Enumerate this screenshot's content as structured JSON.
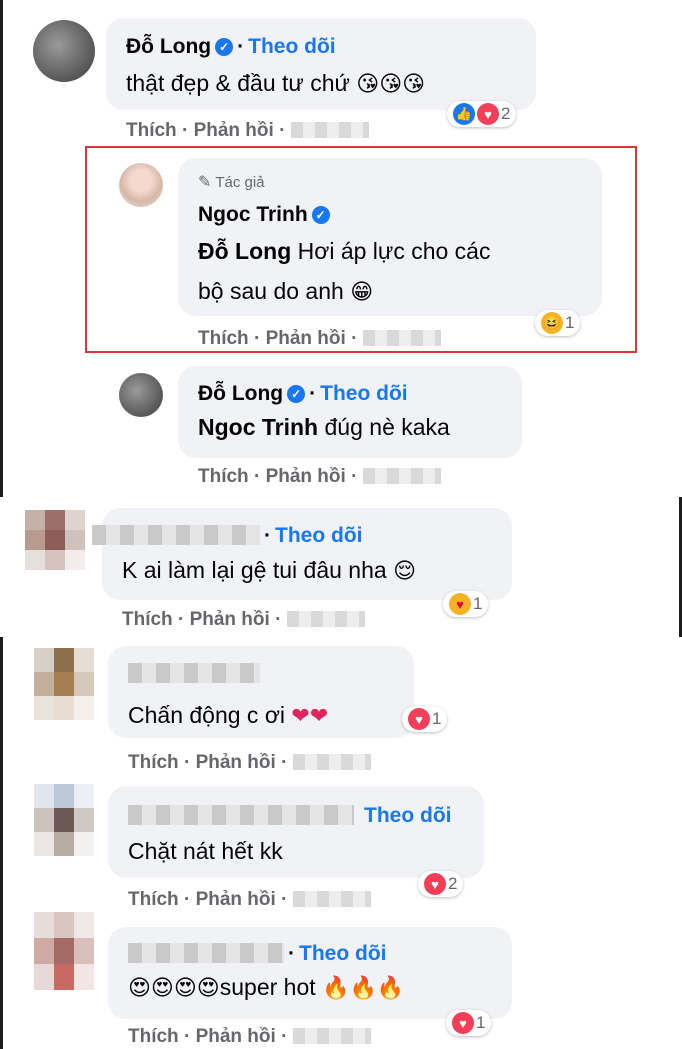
{
  "labels": {
    "follow": "Theo dõi",
    "like": "Thích",
    "reply": "Phản hồi",
    "author_tag": "Tác giả"
  },
  "comments": [
    {
      "name": "Đỗ Long",
      "verified": true,
      "show_follow": true,
      "text": "thật đẹp & đầu tư chứ",
      "emojis": "😘😘😘",
      "reactions": [
        "like-reaction",
        "love-reaction"
      ],
      "reaction_count": "2"
    },
    {
      "name": "Ngoc Trinh",
      "verified": true,
      "is_author": true,
      "mention": "Đỗ Long",
      "text": "Hơi áp lực cho các",
      "text_line2": "bộ sau do anh",
      "emojis": "😁",
      "reactions": [
        "haha-reaction"
      ],
      "reaction_count": "1"
    },
    {
      "name": "Đỗ Long",
      "verified": true,
      "show_follow": true,
      "mention": "Ngoc Trinh",
      "text": "đúg nè kaka"
    },
    {
      "name_blurred": true,
      "show_follow": true,
      "text": "K ai làm lại gệ tui đâu nha",
      "emojis": "😌",
      "reactions": [
        "care-reaction"
      ],
      "reaction_count": "1"
    },
    {
      "name_blurred": true,
      "text": "Chấn động c ơi",
      "emojis": "❤❤",
      "reactions": [
        "love-reaction"
      ],
      "reaction_count": "1"
    },
    {
      "name_blurred": true,
      "show_follow": true,
      "text": "Chặt nát hết kk",
      "reactions": [
        "love-reaction"
      ],
      "reaction_count": "2"
    },
    {
      "name_blurred": true,
      "show_follow": true,
      "text": "super hot",
      "emojis_before": "😍😍😍😍",
      "emojis": "🔥🔥🔥",
      "reactions": [
        "love-reaction"
      ],
      "reaction_count": "1"
    }
  ],
  "colors": {
    "accent": "#1877f2",
    "bubble": "#f0f2f5",
    "highlight_box": "#d33b3b",
    "meta_text": "#65676b"
  }
}
